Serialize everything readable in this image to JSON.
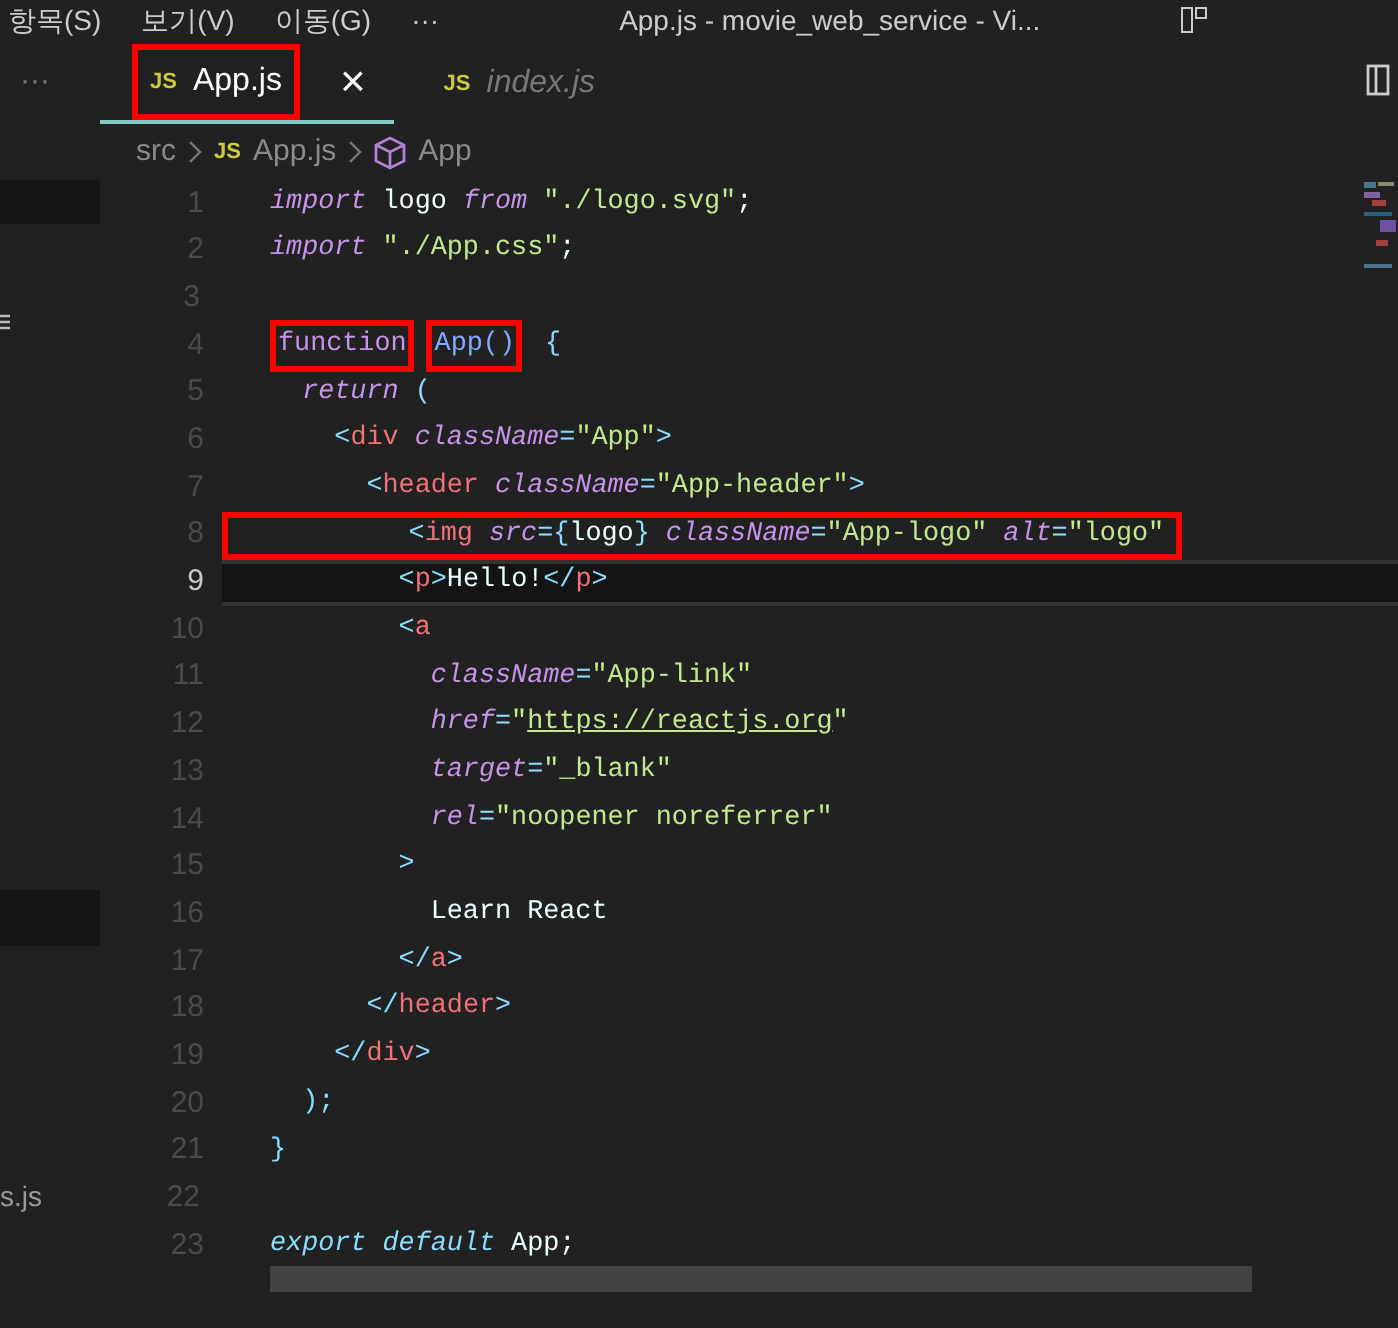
{
  "menu_bar": {
    "items": [
      "항목(S)",
      "보기(V)",
      "이동(G)",
      "···"
    ],
    "title": "App.js - movie_web_service - Vi..."
  },
  "sidebar": {
    "items": [
      {
        "label": "s.js"
      }
    ]
  },
  "tabs": [
    {
      "icon_label": "JS",
      "label": "App.js",
      "selected": true,
      "preview": false,
      "highlighted": true,
      "close": "×"
    },
    {
      "icon_label": "JS",
      "label": "index.js",
      "selected": false,
      "preview": true,
      "highlighted": false
    }
  ],
  "tabs_overflow": "···",
  "breadcrumb": [
    {
      "label": "src",
      "kind": "folder"
    },
    {
      "label": "App.js",
      "kind": "file",
      "icon_label": "JS"
    },
    {
      "label": "App",
      "kind": "symbol"
    }
  ],
  "lines": [
    {
      "number": "1",
      "current": false,
      "highlighted": false,
      "tokens": [
        {
          "t": "import",
          "kind": "kw"
        },
        {
          "t": " logo ",
          "kind": "id"
        },
        {
          "t": "from",
          "kind": "kw"
        },
        {
          "t": " \"./logo.svg\"",
          "kind": "str"
        },
        {
          "t": ";",
          "kind": "id"
        }
      ]
    },
    {
      "number": "2",
      "current": false,
      "highlighted": false,
      "tokens": [
        {
          "t": "import",
          "kind": "kw"
        },
        {
          "t": " \"./App.css\"",
          "kind": "str"
        },
        {
          "t": ";",
          "kind": "id"
        }
      ]
    },
    {
      "number": "3",
      "current": false,
      "highlighted": false
    },
    {
      "number": "4",
      "current": false,
      "highlighted": false,
      "tokens": [
        {
          "t": "function",
          "kind": "fn",
          "box": true
        },
        {
          "t": "App()",
          "kind": "name",
          "box": true
        },
        {
          "t": " {",
          "kind": "punct",
          "box": false
        }
      ]
    },
    {
      "number": "5",
      "current": false,
      "highlighted": false,
      "tokens": [
        {
          "t": "  return",
          "kind": "kw"
        },
        {
          "t": " (",
          "kind": "punct"
        }
      ]
    },
    {
      "number": "6",
      "current": false,
      "highlighted": false,
      "tokens": [
        {
          "t": "    <",
          "kind": "punct"
        },
        {
          "t": "div",
          "kind": "tag"
        },
        {
          "t": " className",
          "kind": "attr"
        },
        {
          "t": "=",
          "kind": "punct"
        },
        {
          "t": "\"App\"",
          "kind": "str"
        },
        {
          "t": ">",
          "kind": "punct"
        }
      ]
    },
    {
      "number": "7",
      "current": false,
      "highlighted": false,
      "tokens": [
        {
          "t": "      <",
          "kind": "punct"
        },
        {
          "t": "header",
          "kind": "tag"
        },
        {
          "t": " className",
          "kind": "attr"
        },
        {
          "t": "=",
          "kind": "punct"
        },
        {
          "t": "\"App-header\"",
          "kind": "str"
        },
        {
          "t": ">",
          "kind": "punct"
        }
      ]
    },
    {
      "number": "8",
      "current": false,
      "highlighted": true,
      "tokens": [
        {
          "t": "        <",
          "kind": "punct"
        },
        {
          "t": "img",
          "kind": "tag"
        },
        {
          "t": " src",
          "kind": "attr"
        },
        {
          "t": "={",
          "kind": "punct"
        },
        {
          "t": "logo",
          "kind": "id"
        },
        {
          "t": "}",
          "kind": "punct"
        },
        {
          "t": " className",
          "kind": "attr"
        },
        {
          "t": "=",
          "kind": "punct"
        },
        {
          "t": "\"App-logo\"",
          "kind": "str"
        },
        {
          "t": " alt",
          "kind": "attr"
        },
        {
          "t": "=",
          "kind": "punct"
        },
        {
          "t": "\"logo\"",
          "kind": "str"
        }
      ]
    },
    {
      "number": "9",
      "current": true,
      "highlighted": false,
      "tokens": [
        {
          "t": "        <",
          "kind": "punct"
        },
        {
          "t": "p",
          "kind": "tag"
        },
        {
          "t": ">",
          "kind": "punct"
        },
        {
          "t": "Hello!",
          "kind": "id"
        },
        {
          "t": "</",
          "kind": "punct"
        },
        {
          "t": "p",
          "kind": "tag"
        },
        {
          "t": ">",
          "kind": "punct"
        }
      ]
    },
    {
      "number": "10",
      "current": false,
      "highlighted": false,
      "tokens": [
        {
          "t": "        <",
          "kind": "punct"
        },
        {
          "t": "a",
          "kind": "tag"
        }
      ]
    },
    {
      "number": "11",
      "current": false,
      "highlighted": false,
      "tokens": [
        {
          "t": "          className",
          "kind": "attr"
        },
        {
          "t": "=",
          "kind": "punct"
        },
        {
          "t": "\"App-link\"",
          "kind": "str"
        }
      ]
    },
    {
      "number": "12",
      "current": false,
      "highlighted": false,
      "tokens": [
        {
          "t": "          href",
          "kind": "attr"
        },
        {
          "t": "=",
          "kind": "punct"
        },
        {
          "t": "\"",
          "kind": "str"
        },
        {
          "t": "https://reactjs.org",
          "kind": "link"
        },
        {
          "t": "\"",
          "kind": "str"
        }
      ]
    },
    {
      "number": "13",
      "current": false,
      "highlighted": false,
      "tokens": [
        {
          "t": "          target",
          "kind": "attr"
        },
        {
          "t": "=",
          "kind": "punct"
        },
        {
          "t": "\"_blank\"",
          "kind": "str"
        }
      ]
    },
    {
      "number": "14",
      "current": false,
      "highlighted": false,
      "tokens": [
        {
          "t": "          rel",
          "kind": "attr"
        },
        {
          "t": "=",
          "kind": "punct"
        },
        {
          "t": "\"noopener noreferrer\"",
          "kind": "str"
        }
      ]
    },
    {
      "number": "15",
      "current": false,
      "highlighted": false,
      "tokens": [
        {
          "t": "        >",
          "kind": "punct"
        }
      ]
    },
    {
      "number": "16",
      "current": false,
      "highlighted": false,
      "tokens": [
        {
          "t": "          Learn React",
          "kind": "id"
        }
      ]
    },
    {
      "number": "17",
      "current": false,
      "highlighted": false,
      "tokens": [
        {
          "t": "        </",
          "kind": "punct"
        },
        {
          "t": "a",
          "kind": "tag"
        },
        {
          "t": ">",
          "kind": "punct"
        }
      ]
    },
    {
      "number": "18",
      "current": false,
      "highlighted": false,
      "tokens": [
        {
          "t": "      </",
          "kind": "punct"
        },
        {
          "t": "header",
          "kind": "tag"
        },
        {
          "t": ">",
          "kind": "punct"
        }
      ]
    },
    {
      "number": "19",
      "current": false,
      "highlighted": false,
      "tokens": [
        {
          "t": "    </",
          "kind": "punct"
        },
        {
          "t": "div",
          "kind": "tag"
        },
        {
          "t": ">",
          "kind": "punct"
        }
      ]
    },
    {
      "number": "20",
      "current": false,
      "highlighted": false,
      "tokens": [
        {
          "t": "  );",
          "kind": "punct"
        }
      ]
    },
    {
      "number": "21",
      "current": false,
      "highlighted": false,
      "tokens": [
        {
          "t": "}",
          "kind": "punct"
        }
      ]
    },
    {
      "number": "22",
      "current": false,
      "highlighted": false
    },
    {
      "number": "23",
      "current": false,
      "highlighted": false,
      "tokens": [
        {
          "t": "export",
          "kind": "kw2"
        },
        {
          "t": " default",
          "kind": "kw2"
        },
        {
          "t": " App;",
          "kind": "id"
        }
      ]
    }
  ]
}
